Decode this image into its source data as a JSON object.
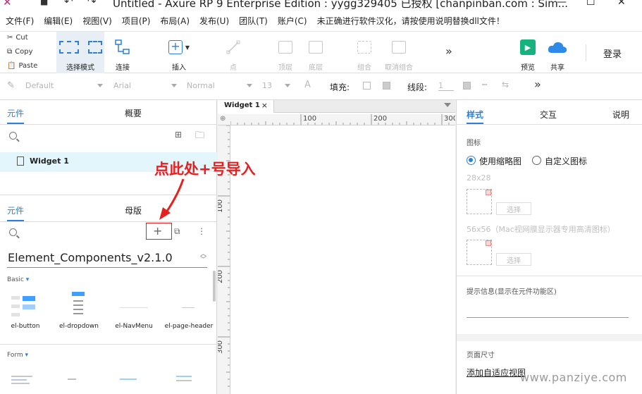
{
  "window": {
    "title": "Untitled - Axure RP 9 Enterprise Edition : yygg329405 已授权     [chanpinban.com : Sim..."
  },
  "menu": [
    "文件(F)",
    "编辑(E)",
    "视图(V)",
    "项目(P)",
    "布局(A)",
    "发布(U)",
    "团队(T)",
    "账户(C)",
    "未正确进行软件汉化，请按使用说明替换dll文件！"
  ],
  "clipboard": {
    "cut": "Cut",
    "copy": "Copy",
    "paste": "Paste"
  },
  "toolbar": {
    "select_mode": "选择模式",
    "connect": "连接",
    "insert": "插入",
    "point": "点",
    "top_layer": "顶层",
    "bottom_layer": "底层",
    "group": "组合",
    "ungroup": "取消组合",
    "preview": "预览",
    "share": "共享",
    "login": "登录"
  },
  "formatbar": {
    "style": "Default",
    "font": "Arial",
    "weight": "Normal",
    "size": "13",
    "fill_label": "填充:",
    "line_label": "线段:",
    "line_width": "1"
  },
  "left_top": {
    "tab_active": "元件",
    "tab_other": "概要",
    "page_item": "Widget 1"
  },
  "left_bottom": {
    "tab_active": "元件",
    "tab_other": "母版",
    "library": "Element_Components_v2.1.0",
    "section_basic": "Basic",
    "section_form": "Form",
    "components": [
      "el-button",
      "el-dropdown",
      "el-NavMenu",
      "el-page-header"
    ]
  },
  "canvas": {
    "tab": "Widget 1",
    "tab_close": "×",
    "h_ruler": [
      "100",
      "200",
      "300"
    ],
    "v_ruler": [
      "100",
      "200",
      "300"
    ]
  },
  "right": {
    "tabs": [
      "样式",
      "交互",
      "说明"
    ],
    "icon_label": "图标",
    "radio_thumb": "使用缩略图",
    "radio_custom": "自定义图标",
    "size1": "28x28",
    "size2": "56x56（Mac视网膜显示器专用高清图标）",
    "select_btn": "选择",
    "tooltip_label": "提示信息(显示在元件功能区)",
    "page_size": "页面尺寸",
    "adaptive_link": "添加自适应视图"
  },
  "annotation": {
    "text": "点此处+号导入"
  },
  "watermark": "www.panziye.com",
  "colors": {
    "accent": "#2f7fd8",
    "annotation_red": "#e81f1f",
    "preview_green": "#16b37e",
    "share_blue": "#2e8ae6"
  }
}
